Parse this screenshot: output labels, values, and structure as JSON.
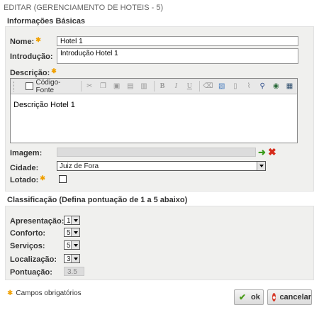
{
  "page": {
    "title": "EDITAR (GERENCIAMENTO DE HOTEIS - 5)"
  },
  "basic": {
    "section_title": "Informações Básicas",
    "nome_label": "Nome:",
    "nome_value": "Hotel 1",
    "introducao_label": "Introdução:",
    "introducao_value": "Introdução Hotel 1",
    "descricao_label": "Descrição:",
    "descricao_value": "Descrição Hotel 1",
    "toolbar": {
      "source_label": "Código-Fonte",
      "buttons": [
        "cut-icon",
        "copy-icon",
        "paste-icon",
        "paste-text-icon",
        "paste-word-icon",
        "bold-icon",
        "italic-icon",
        "underline-icon",
        "eraser-icon",
        "image-icon",
        "new-page-icon",
        "attach-icon",
        "find-icon",
        "link-icon",
        "table-icon"
      ]
    },
    "imagem_label": "Imagem:",
    "imagem_value": "",
    "cidade_label": "Cidade:",
    "cidade_value": "Juiz de Fora",
    "lotado_label": "Lotado:",
    "lotado_checked": false
  },
  "classification": {
    "section_title": "Classificação (Defina pontuação de 1 a 5 abaixo)",
    "apresentacao_label": "Apresentação:",
    "apresentacao_value": "1",
    "conforto_label": "Conforto:",
    "conforto_value": "5",
    "servicos_label": "Serviços:",
    "servicos_value": "5",
    "localizacao_label": "Localização:",
    "localizacao_value": "3",
    "pontuacao_label": "Pontuação:",
    "pontuacao_value": "3.5"
  },
  "footer": {
    "required_note": "Campos obrigatórios",
    "ok_label": "ok",
    "cancel_label": "cancelar"
  },
  "colors": {
    "required_star": "#f0a000",
    "ok_icon": "#4a9b1a",
    "cancel_icon": "#d63a2a",
    "panel_bg": "#f0f0ee"
  }
}
